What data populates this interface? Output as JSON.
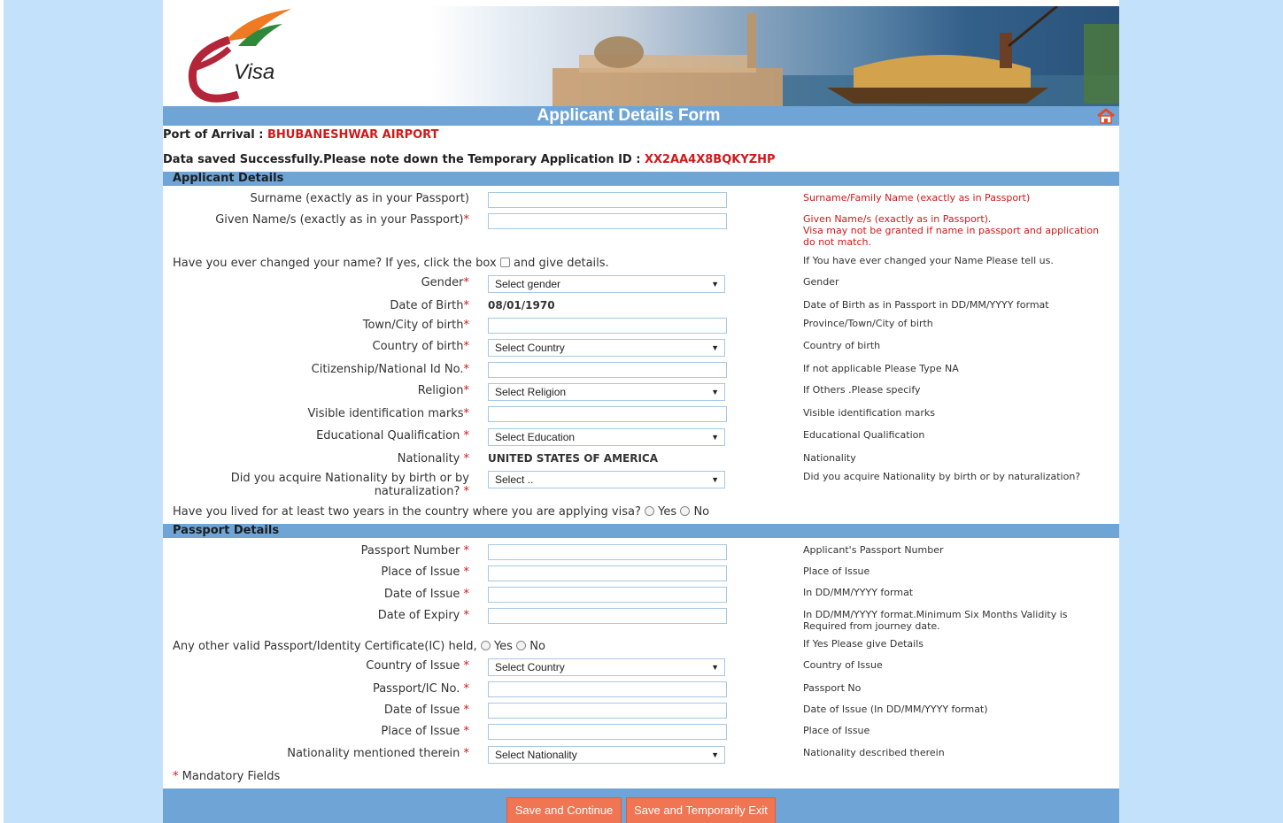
{
  "header": {
    "logo_text": "Visa",
    "logo_e": "e",
    "title": "Applicant Details Form"
  },
  "info": {
    "port_label": "Port of Arrival : ",
    "port_value": "BHUBANESHWAR AIRPORT",
    "saved_label": "Data saved Successfully.Please note down the Temporary Application ID : ",
    "saved_value": "XX2AA4X8BQKYZHP"
  },
  "applicant": {
    "section_title": "Applicant Details",
    "surname_label": "Surname (exactly as in your Passport)",
    "surname_hint": "Surname/Family Name (exactly as in Passport)",
    "given_label": "Given Name/s (exactly as in your Passport)",
    "given_hint_1": "Given Name/s (exactly as in Passport).",
    "given_hint_2": "Visa may not be granted if name in passport and application do not match.",
    "changed_label": "Have you ever changed your name? If yes, click the box",
    "changed_after": "and give details.",
    "changed_hint": "If You have ever changed your Name Please tell us.",
    "gender_label": "Gender",
    "gender_value": "Select gender",
    "gender_hint": "Gender",
    "dob_label": "Date of Birth",
    "dob_value": "08/01/1970",
    "dob_hint": "Date of Birth as in Passport in DD/MM/YYYY format",
    "town_label": "Town/City of birth",
    "town_hint": "Province/Town/City of birth",
    "country_label": "Country of birth",
    "country_value": "Select Country",
    "country_hint": "Country of birth",
    "citizen_label": "Citizenship/National Id No.",
    "citizen_hint": "If not applicable Please Type NA",
    "religion_label": "Religion",
    "religion_value": "Select Religion",
    "religion_hint": "If Others .Please specify",
    "marks_label": "Visible identification marks",
    "marks_hint": "Visible identification marks",
    "edu_label": "Educational Qualification ",
    "edu_value": "Select Education",
    "edu_hint": "Educational Qualification",
    "nat_label": "Nationality ",
    "nat_value": "UNITED STATES OF AMERICA",
    "nat_hint": "Nationality",
    "acq_label_1": "Did you acquire Nationality by birth or by",
    "acq_label_2": "naturalization? ",
    "acq_value": "Select ..",
    "acq_hint": "Did you acquire Nationality by birth or by naturalization?",
    "lived_label": "Have you lived for at least two years in the country where you are applying visa?",
    "yes": "Yes",
    "no": "No"
  },
  "passport": {
    "section_title": "Passport Details",
    "number_label": "Passport Number ",
    "number_hint": "Applicant's Passport Number",
    "place_label": "Place of Issue ",
    "place_hint": "Place of Issue",
    "doi_label": "Date of Issue ",
    "doi_hint": "In DD/MM/YYYY format",
    "doe_label": "Date of Expiry ",
    "doe_hint": "In DD/MM/YYYY format.Minimum Six Months Validity is Required from journey date.",
    "other_label": "Any other valid Passport/Identity Certificate(IC) held,",
    "other_hint": "If Yes Please give Details",
    "coi_label": "Country of Issue ",
    "coi_value": "Select Country",
    "coi_hint": "Country of Issue",
    "ic_label": "Passport/IC No. ",
    "ic_hint": "Passport No",
    "ic_doi_label": "Date of Issue ",
    "ic_doi_hint": "Date of Issue (In DD/MM/YYYY format)",
    "ic_place_label": "Place of Issue ",
    "ic_place_hint": "Place of Issue",
    "ic_nat_label": "Nationality mentioned therein ",
    "ic_nat_value": "Select Nationality",
    "ic_nat_hint": "Nationality described therein"
  },
  "star": "*",
  "mandatory": "Mandatory Fields",
  "buttons": {
    "save_continue": "Save and Continue",
    "save_exit": "Save and Temporarily Exit"
  }
}
